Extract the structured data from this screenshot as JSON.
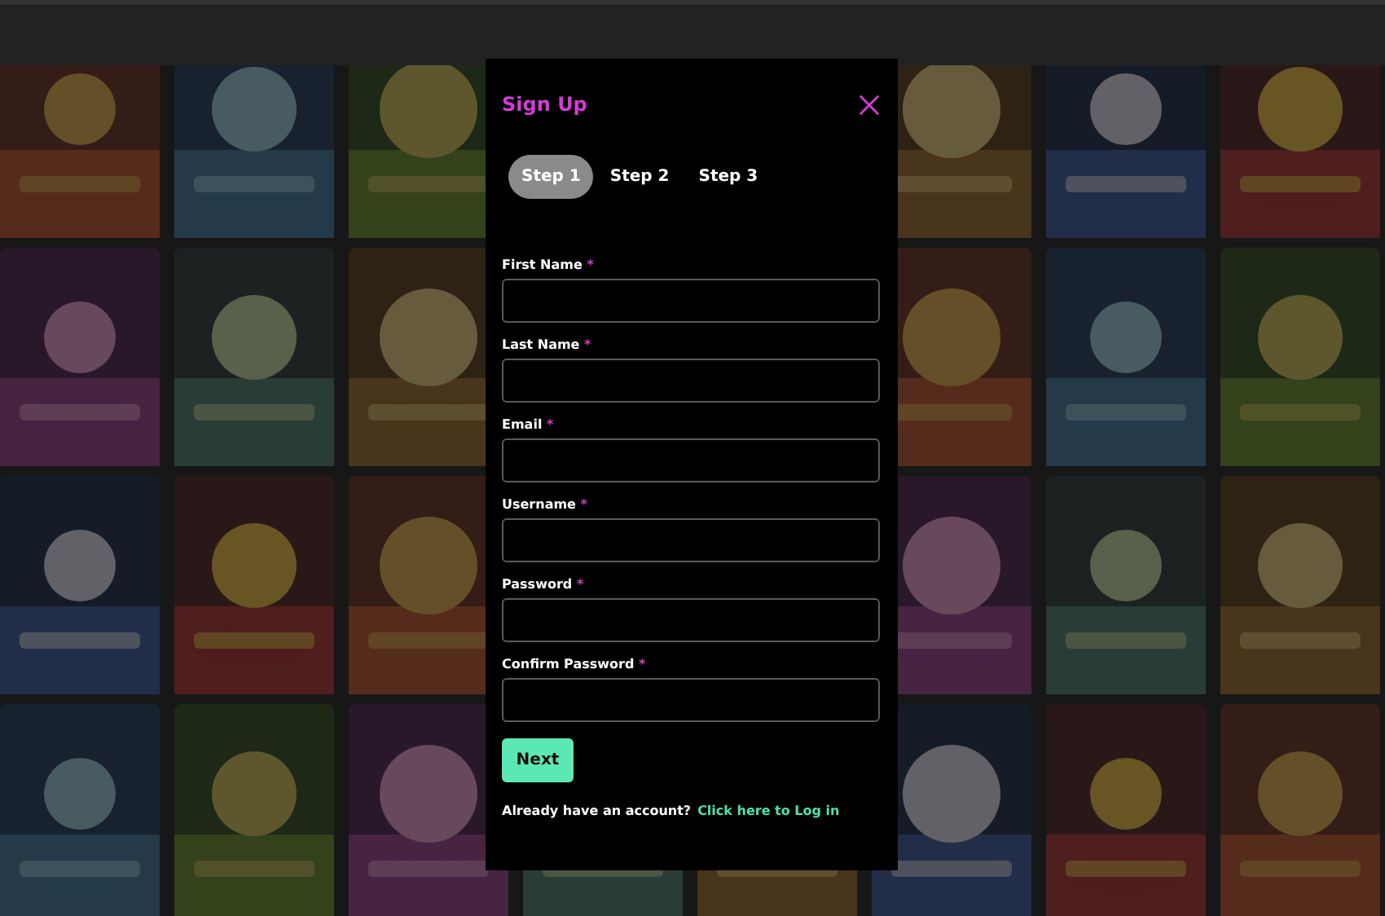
{
  "dialog": {
    "title": "Sign Up",
    "steps": [
      {
        "label": "Step 1",
        "selected": true
      },
      {
        "label": "Step 2",
        "selected": false
      },
      {
        "label": "Step 3",
        "selected": false
      }
    ],
    "fields": [
      {
        "label": "First Name",
        "required_mark": "*"
      },
      {
        "label": "Last Name",
        "required_mark": "*"
      },
      {
        "label": "Email",
        "required_mark": "*"
      },
      {
        "label": "Username",
        "required_mark": "*"
      },
      {
        "label": "Password",
        "required_mark": "*"
      },
      {
        "label": "Confirm Password",
        "required_mark": "*"
      }
    ],
    "submit": "Next",
    "footer": {
      "text": "Already have an account?",
      "link": "Click here to Log in"
    }
  }
}
